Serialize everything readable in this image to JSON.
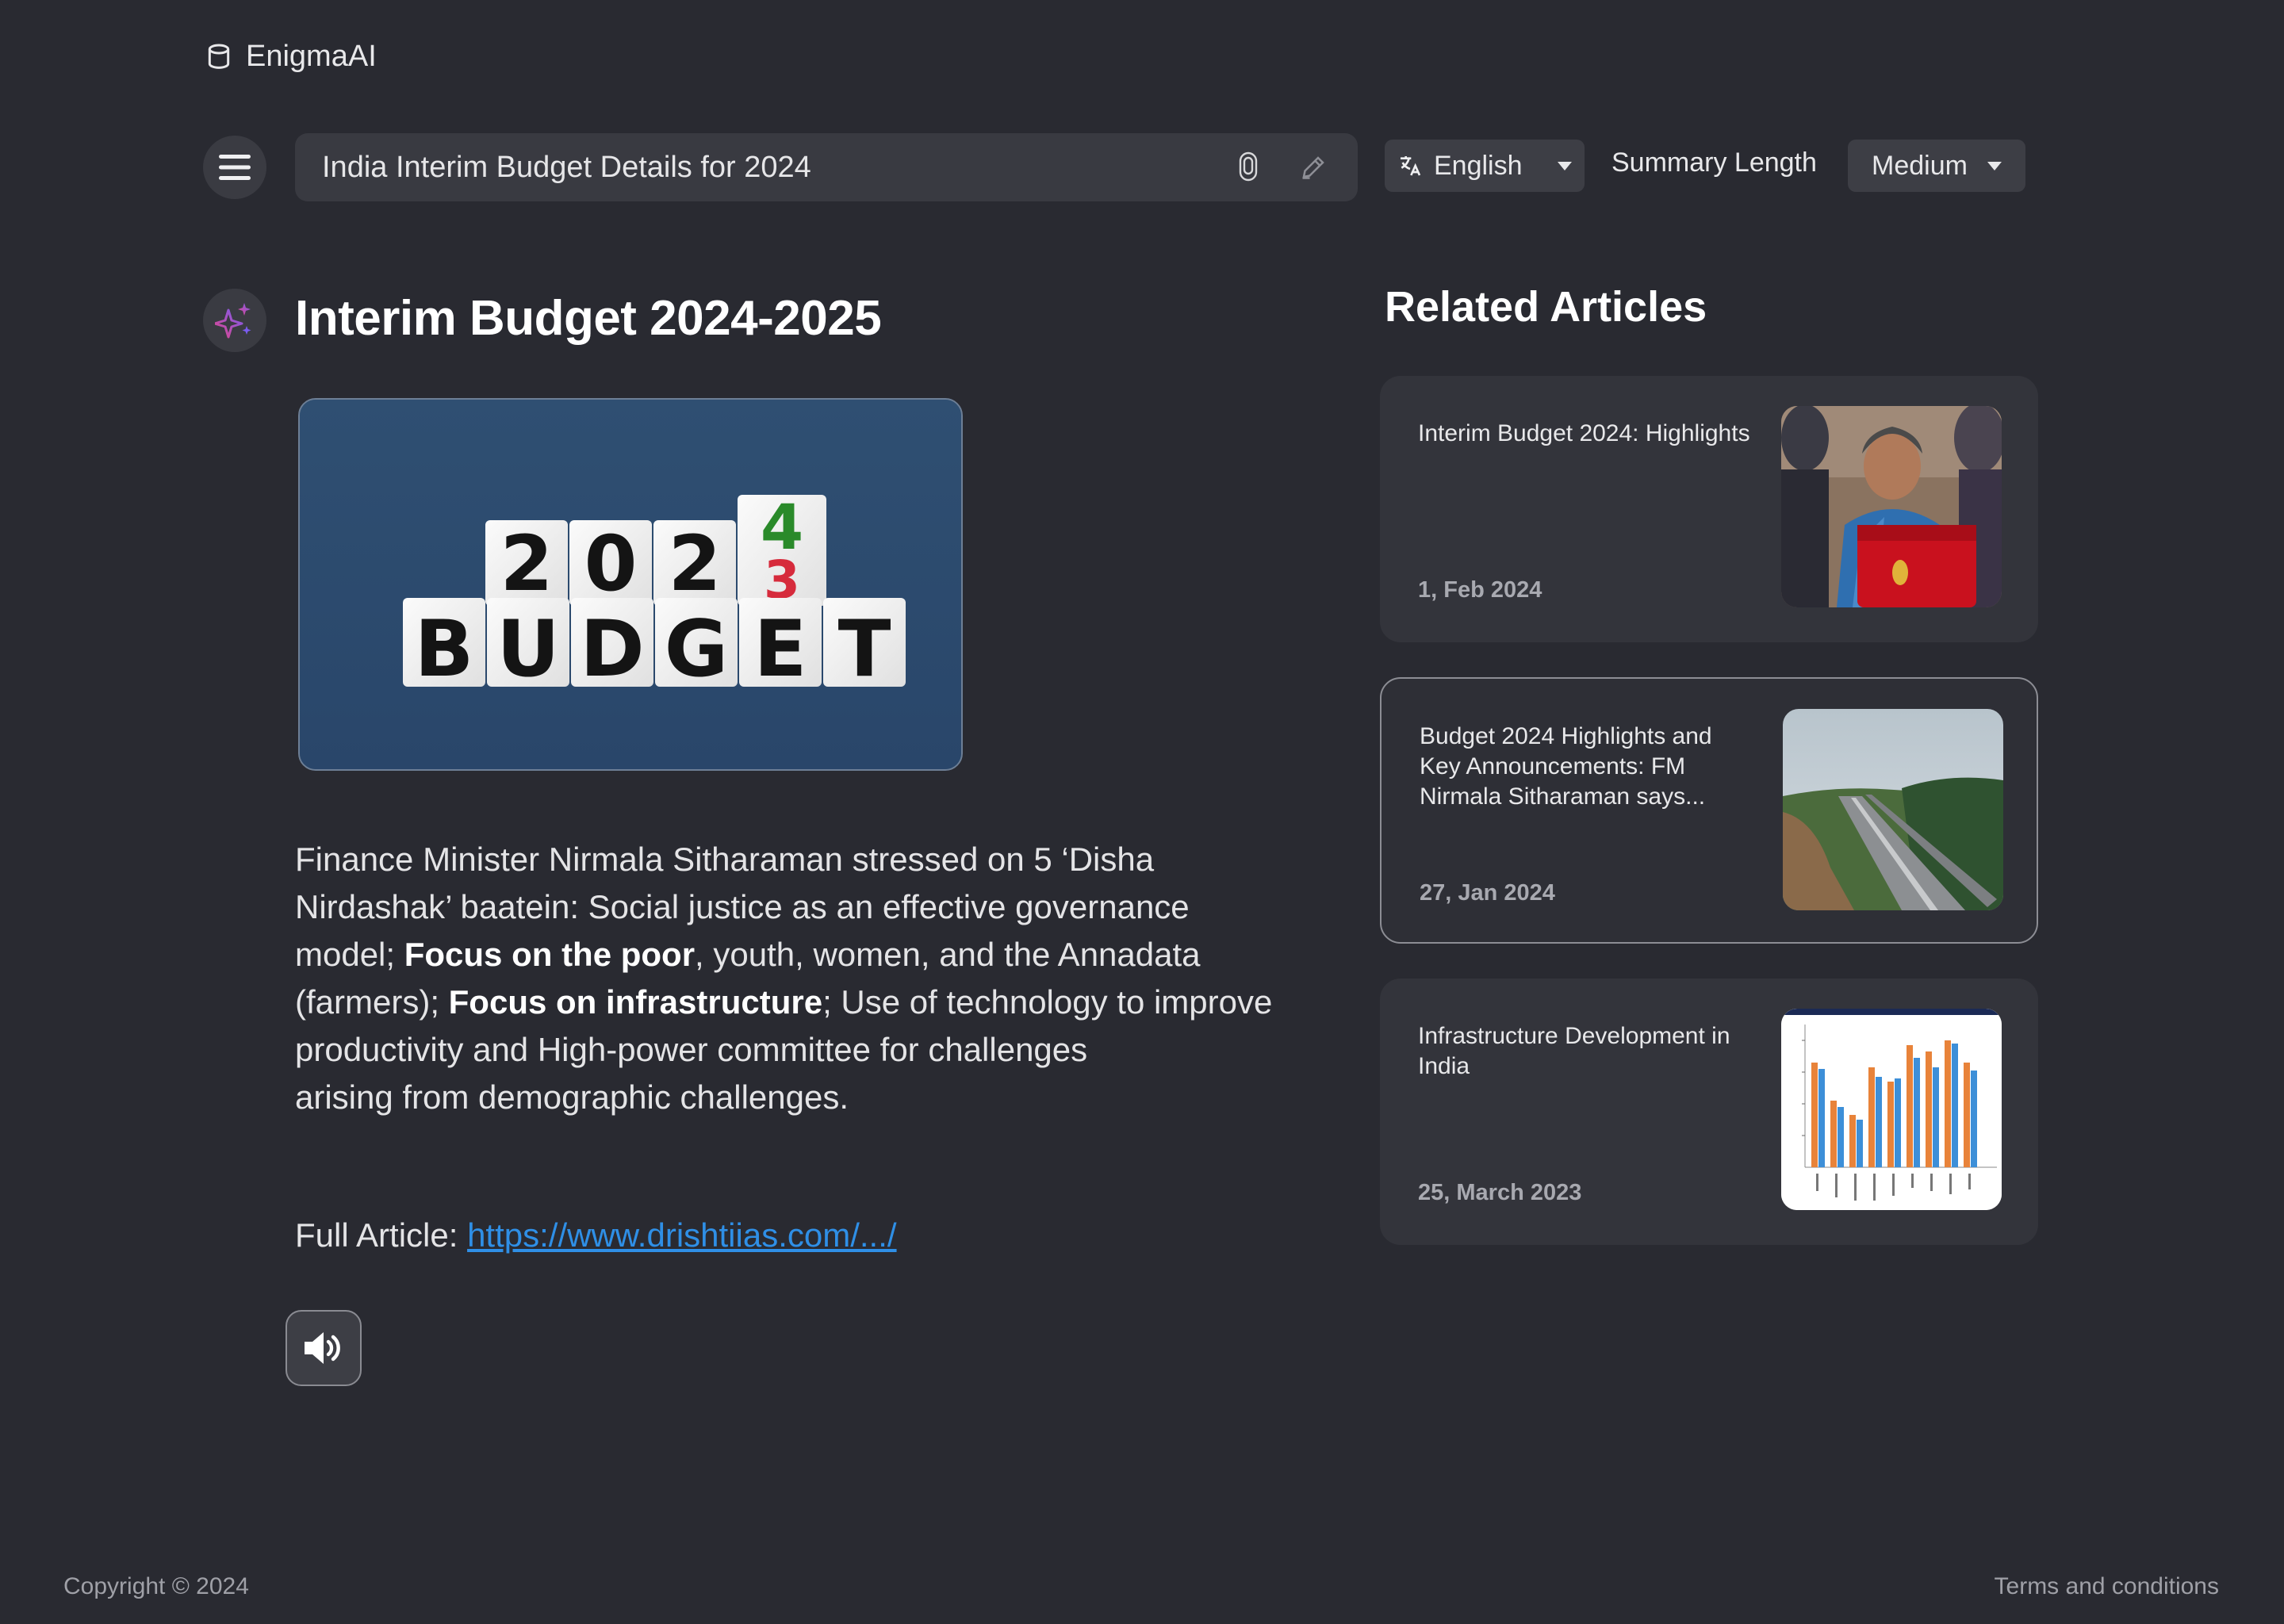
{
  "brand": {
    "name": "EnigmaAI",
    "icon": "cylinder-logo-icon"
  },
  "search": {
    "query": "India Interim Budget Details for 2024",
    "mic_icon": "microphone-icon",
    "edit_icon": "pencil-icon"
  },
  "language": {
    "selected": "English",
    "icon": "translate-icon"
  },
  "summary_length": {
    "label": "Summary Length",
    "selected": "Medium"
  },
  "article": {
    "title": "Interim Budget 2024-2025",
    "image": {
      "tiles_top": [
        "2",
        "0",
        "2"
      ],
      "flip_new": "4",
      "flip_old": "3",
      "tiles_bottom": [
        "B",
        "U",
        "D",
        "G",
        "E",
        "T"
      ]
    },
    "summary": {
      "p1": "Finance Minister Nirmala Sitharaman stressed on 5 ‘Disha Nirdashak’ baatein: Social justice as an effective governance model; ",
      "b1": "Focus on the poor",
      "p2": ", youth, women, and the Annadata (farmers); ",
      "b2": "Focus on infrastructure",
      "p3": "; Use of technology to improve productivity and High-power committee for challenges",
      "p4": "arising from demographic challenges."
    },
    "full_label": "Full Article: ",
    "full_link": "https://www.drishtiias.com/.../"
  },
  "related": {
    "heading": "Related Articles",
    "items": [
      {
        "title": "Interim Budget 2024: Highlights",
        "date": "1, Feb 2024"
      },
      {
        "title": "Budget 2024 Highlights and Key Announcements: FM Nirmala Sitharaman says...",
        "date": "27, Jan 2024"
      },
      {
        "title": "Infrastructure Development in India",
        "date": "25, March 2023"
      }
    ]
  },
  "footer": {
    "copyright": "Copyright © 2024",
    "terms": "Terms and conditions"
  }
}
